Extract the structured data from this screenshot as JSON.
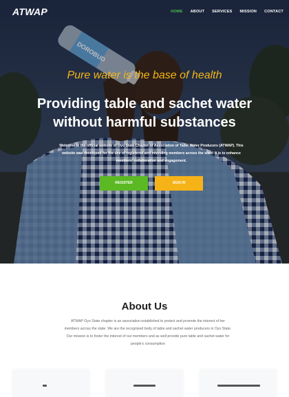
{
  "brand": "ATWAP",
  "nav": {
    "items": [
      {
        "label": "HOME",
        "active": true
      },
      {
        "label": "ABOUT",
        "active": false
      },
      {
        "label": "SERVICES",
        "active": false
      },
      {
        "label": "MISSION",
        "active": false
      },
      {
        "label": "CONTACT",
        "active": false
      }
    ]
  },
  "hero": {
    "tagline": "Pure water is the base of health",
    "headline": "Providing table and sachet water without harmful substances",
    "intro": "Welcome to the official website of Oyo State Chapter of Association of Table Water Producers (ATWAP). This website was developed for the use of registered and intending members across the state. It is to enhance members' collaboration and engagement.",
    "register_label": "REGISTER",
    "signin_label": "SIGN IN",
    "bottle_label": "DOROBUD"
  },
  "about": {
    "title": "About Us",
    "text": "ATWAP Oyo State chapter is an association established to protect and promote the interest of her members across the state. We are the recognised body of table and sachet water producers in Oyo State. Our mission is to foster the interest of our members and as well provide pure table and sachet water for people's consumption"
  },
  "colors": {
    "accent_green": "#5bb924",
    "accent_yellow": "#f6b318",
    "nav_active": "#4cc14f",
    "tagline": "#f5b617"
  }
}
